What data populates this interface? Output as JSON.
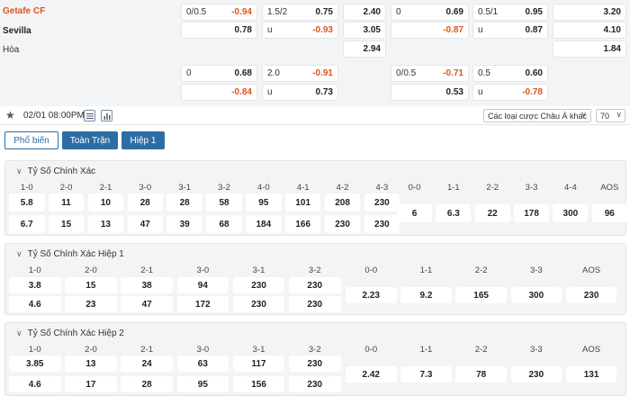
{
  "top": {
    "teams": [
      {
        "name": "Getafe CF",
        "color": "#e0531f",
        "bold": true
      },
      {
        "name": "Sevilla",
        "color": "#222222",
        "bold": true
      },
      {
        "name": "Hòa",
        "color": "#333333",
        "bold": false
      }
    ],
    "rows": [
      {
        "ah": {
          "h": "0/0.5",
          "o": "-0.94"
        },
        "ou": {
          "h": "1.5/2",
          "o": "0.75"
        },
        "x12": "2.40",
        "ah1": {
          "h": "0",
          "o": "0.69"
        },
        "ou1": {
          "h": "0.5/1",
          "o": "0.95"
        },
        "x121": "3.20"
      },
      {
        "ah": {
          "h": "",
          "o": "0.78"
        },
        "ou": {
          "h": "u",
          "o": "-0.93"
        },
        "x12": "3.05",
        "ah1": {
          "h": "",
          "o": "-0.87"
        },
        "ou1": {
          "h": "u",
          "o": "0.87"
        },
        "x121": "4.10"
      },
      {
        "x12": "2.94",
        "x121": "1.84"
      },
      {
        "ah": {
          "h": "0",
          "o": "0.68"
        },
        "ou": {
          "h": "2.0",
          "o": "-0.91"
        },
        "ah1": {
          "h": "0/0.5",
          "o": "-0.71"
        },
        "ou1": {
          "h": "0.5",
          "o": "0.60"
        }
      },
      {
        "ah": {
          "h": "",
          "o": "-0.84"
        },
        "ou": {
          "h": "u",
          "o": "0.73"
        },
        "ah1": {
          "h": "",
          "o": "0.53"
        },
        "ou1": {
          "h": "u",
          "o": "-0.78"
        }
      }
    ]
  },
  "toolbar": {
    "datetime": "02/01 08:00PM",
    "bet_type": "Các loại cược Châu Á khác",
    "count": "70"
  },
  "tabs": [
    {
      "label": "Phổ biến",
      "state": "active"
    },
    {
      "label": "Toàn Trận",
      "state": "blue"
    },
    {
      "label": "Hiệp 1",
      "state": "blue"
    }
  ],
  "sections": [
    {
      "title": "Tỷ Số Chính Xác",
      "left_headers": [
        "1-0",
        "2-0",
        "2-1",
        "3-0",
        "3-1",
        "3-2",
        "4-0",
        "4-1",
        "4-2",
        "4-3"
      ],
      "left_rows": [
        [
          "5.8",
          "11",
          "10",
          "28",
          "28",
          "58",
          "95",
          "101",
          "208",
          "230"
        ],
        [
          "6.7",
          "15",
          "13",
          "47",
          "39",
          "68",
          "184",
          "166",
          "230",
          "230"
        ]
      ],
      "right_headers": [
        "0-0",
        "1-1",
        "2-2",
        "3-3",
        "4-4",
        "AOS"
      ],
      "right_values": [
        "6",
        "6.3",
        "22",
        "178",
        "300",
        "96"
      ]
    },
    {
      "title": "Tỷ Số Chính Xác Hiệp 1",
      "left_headers": [
        "1-0",
        "2-0",
        "2-1",
        "3-0",
        "3-1",
        "3-2"
      ],
      "left_rows": [
        [
          "3.8",
          "15",
          "38",
          "94",
          "230",
          "230"
        ],
        [
          "4.6",
          "23",
          "47",
          "172",
          "230",
          "230"
        ]
      ],
      "right_headers": [
        "0-0",
        "1-1",
        "2-2",
        "3-3",
        "AOS"
      ],
      "right_values": [
        "2.23",
        "9.2",
        "165",
        "300",
        "230"
      ]
    },
    {
      "title": "Tỷ Số Chính Xác Hiệp 2",
      "left_headers": [
        "1-0",
        "2-0",
        "2-1",
        "3-0",
        "3-1",
        "3-2"
      ],
      "left_rows": [
        [
          "3.85",
          "13",
          "24",
          "63",
          "117",
          "230"
        ],
        [
          "4.6",
          "17",
          "28",
          "95",
          "156",
          "230"
        ]
      ],
      "right_headers": [
        "0-0",
        "1-1",
        "2-2",
        "3-3",
        "AOS"
      ],
      "right_values": [
        "2.42",
        "7.3",
        "78",
        "230",
        "131"
      ]
    }
  ]
}
